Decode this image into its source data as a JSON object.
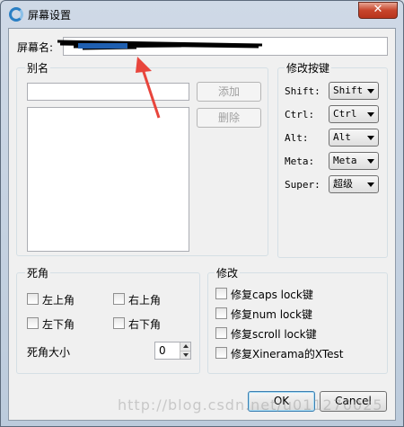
{
  "window": {
    "title": "屏幕设置",
    "close_glyph": "✕"
  },
  "screen_name": {
    "label": "屏幕名:",
    "value": ""
  },
  "alias": {
    "group_title": "别名",
    "input_value": "",
    "add_label": "添加",
    "remove_label": "删除",
    "items": []
  },
  "modifier_keys": {
    "group_title": "修改按键",
    "rows": [
      {
        "label": "Shift:",
        "value": "Shift"
      },
      {
        "label": "Ctrl:",
        "value": "Ctrl"
      },
      {
        "label": "Alt:",
        "value": "Alt"
      },
      {
        "label": "Meta:",
        "value": "Meta"
      },
      {
        "label": "Super:",
        "value": "超级"
      }
    ]
  },
  "dead_corners": {
    "group_title": "死角",
    "top_left": "左上角",
    "top_right": "右上角",
    "bottom_left": "左下角",
    "bottom_right": "右下角",
    "size_label": "死角大小",
    "size_value": "0"
  },
  "fixes": {
    "group_title": "修改",
    "items": [
      "修复caps lock键",
      "修复num lock键",
      "修复scroll lock键",
      "修复Xinerama的XTest"
    ]
  },
  "buttons": {
    "ok": "OK",
    "cancel": "Cancel"
  },
  "watermark": "http://blog.csdn.net/u011270025",
  "colors": {
    "accent": "#2a7fc4",
    "annotation_arrow": "#e8453c"
  }
}
